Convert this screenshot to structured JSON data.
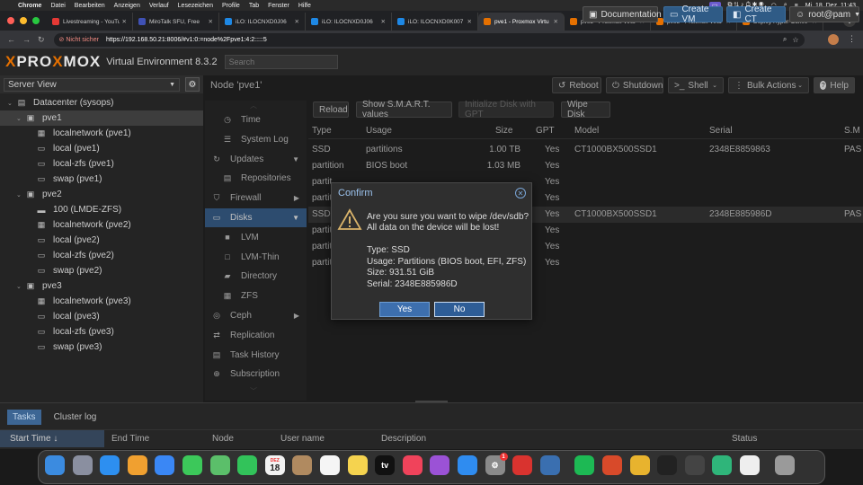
{
  "menubar": {
    "apple": "",
    "app": "Chrome",
    "items": [
      "Datei",
      "Bearbeiten",
      "Anzeigen",
      "Verlauf",
      "Lesezeichen",
      "Profile",
      "Tab",
      "Fenster",
      "Hilfe"
    ],
    "datetime": "Mi. 18. Dez.  11:43"
  },
  "tabs": [
    {
      "label": "Livestreaming - YouTube",
      "color": "#e53935"
    },
    {
      "label": "MiroTalk SFU, Free",
      "color": "#3f51b5"
    },
    {
      "label": "iLO: ILOCNXD0J06",
      "color": "#1e88e5"
    },
    {
      "label": "iLO: ILOCNXD0J06",
      "color": "#1e88e5"
    },
    {
      "label": "iLO: ILOCNXD0K007",
      "color": "#1e88e5"
    },
    {
      "label": "pve1 - Proxmox Virtu",
      "color": "#e57000",
      "active": true
    },
    {
      "label": "pve2 - Proxmox Virtu",
      "color": "#e57000"
    },
    {
      "label": "pve3 - Proxmox Virtu",
      "color": "#e57000"
    },
    {
      "label": "Deploy Hyper-Conve",
      "color": "#e57000"
    }
  ],
  "address": {
    "secure": "Nicht sicher",
    "url": "https://192.168.50.21:8006/#v1:0:=node%2Fpve1:4:2:::::5"
  },
  "header": {
    "logo_a": "PRO",
    "logo_x": "X",
    "logo_b": "MOX",
    "logo_prefix": "",
    "product": "Virtual Environment 8.3.2",
    "search_placeholder": "Search",
    "documentation": "Documentation",
    "create_vm": "Create VM",
    "create_ct": "Create CT",
    "user": "root@pam"
  },
  "left": {
    "view": "Server View",
    "tree": [
      {
        "label": "Datacenter (sysops)",
        "indent": 0,
        "icon": "datacenter-icon",
        "glyph": "▤"
      },
      {
        "label": "pve1",
        "indent": 1,
        "icon": "node-icon",
        "glyph": "▣",
        "selected": true
      },
      {
        "label": "localnetwork (pve1)",
        "indent": 2,
        "icon": "network-icon",
        "glyph": "▦"
      },
      {
        "label": "local (pve1)",
        "indent": 2,
        "icon": "storage-icon",
        "glyph": "▭"
      },
      {
        "label": "local-zfs (pve1)",
        "indent": 2,
        "icon": "storage-icon",
        "glyph": "▭"
      },
      {
        "label": "swap (pve1)",
        "indent": 2,
        "icon": "storage-icon",
        "glyph": "▭"
      },
      {
        "label": "pve2",
        "indent": 1,
        "icon": "node-icon",
        "glyph": "▣"
      },
      {
        "label": "100 (LMDE-ZFS)",
        "indent": 2,
        "icon": "vm-icon",
        "glyph": "▬"
      },
      {
        "label": "localnetwork (pve2)",
        "indent": 2,
        "icon": "network-icon",
        "glyph": "▦"
      },
      {
        "label": "local (pve2)",
        "indent": 2,
        "icon": "storage-icon",
        "glyph": "▭"
      },
      {
        "label": "local-zfs (pve2)",
        "indent": 2,
        "icon": "storage-icon",
        "glyph": "▭"
      },
      {
        "label": "swap (pve2)",
        "indent": 2,
        "icon": "storage-icon",
        "glyph": "▭"
      },
      {
        "label": "pve3",
        "indent": 1,
        "icon": "node-icon",
        "glyph": "▣"
      },
      {
        "label": "localnetwork (pve3)",
        "indent": 2,
        "icon": "network-icon",
        "glyph": "▦"
      },
      {
        "label": "local (pve3)",
        "indent": 2,
        "icon": "storage-icon",
        "glyph": "▭"
      },
      {
        "label": "local-zfs (pve3)",
        "indent": 2,
        "icon": "storage-icon",
        "glyph": "▭"
      },
      {
        "label": "swap (pve3)",
        "indent": 2,
        "icon": "storage-icon",
        "glyph": "▭"
      }
    ]
  },
  "node": {
    "title": "Node 'pve1'",
    "reboot": "Reboot",
    "shutdown": "Shutdown",
    "shell": "Shell",
    "bulk": "Bulk Actions",
    "help": "Help"
  },
  "menu": [
    {
      "label": "Time",
      "icon": "clock-icon",
      "glyph": "◷",
      "sub": true
    },
    {
      "label": "System Log",
      "icon": "list-icon",
      "glyph": "☰",
      "sub": true
    },
    {
      "label": "Updates",
      "icon": "refresh-icon",
      "glyph": "↻",
      "arrow": "▼"
    },
    {
      "label": "Repositories",
      "icon": "files-icon",
      "glyph": "▤",
      "sub": true
    },
    {
      "label": "Firewall",
      "icon": "shield-icon",
      "glyph": "⛉",
      "arrow": "▶"
    },
    {
      "label": "Disks",
      "icon": "disk-icon",
      "glyph": "▭",
      "arrow": "▼",
      "active": true
    },
    {
      "label": "LVM",
      "icon": "square-icon",
      "glyph": "■",
      "sub": true
    },
    {
      "label": "LVM-Thin",
      "icon": "square-outline-icon",
      "glyph": "□",
      "sub": true
    },
    {
      "label": "Directory",
      "icon": "folder-icon",
      "glyph": "▰",
      "sub": true
    },
    {
      "label": "ZFS",
      "icon": "grid-icon",
      "glyph": "▦",
      "sub": true
    },
    {
      "label": "Ceph",
      "icon": "ceph-icon",
      "glyph": "◎",
      "arrow": "▶"
    },
    {
      "label": "Replication",
      "icon": "retweet-icon",
      "glyph": "⇄"
    },
    {
      "label": "Task History",
      "icon": "list-alt-icon",
      "glyph": "▤"
    },
    {
      "label": "Subscription",
      "icon": "support-icon",
      "glyph": "⊕"
    }
  ],
  "disk_toolbar": {
    "reload": "Reload",
    "smart": "Show S.M.A.R.T. values",
    "init": "Initialize Disk with GPT",
    "wipe": "Wipe Disk"
  },
  "columns": {
    "type": "Type",
    "usage": "Usage",
    "size": "Size",
    "gpt": "GPT",
    "model": "Model",
    "serial": "Serial",
    "sm": "S.M"
  },
  "rows": [
    {
      "type": "SSD",
      "usage": "partitions",
      "size": "1.00 TB",
      "gpt": "Yes",
      "model": "CT1000BX500SSD1",
      "serial": "2348E8859863",
      "sm": "PAS"
    },
    {
      "type": "partition",
      "usage": "BIOS boot",
      "size": "1.03 MB",
      "gpt": "Yes",
      "model": "",
      "serial": "",
      "sm": ""
    },
    {
      "type": "partit",
      "usage": "",
      "size": "",
      "gpt": "Yes",
      "model": "",
      "serial": "",
      "sm": ""
    },
    {
      "type": "partit",
      "usage": "",
      "size": "",
      "gpt": "Yes",
      "model": "",
      "serial": "",
      "sm": ""
    },
    {
      "type": "SSD",
      "usage": "",
      "size": "",
      "gpt": "Yes",
      "model": "CT1000BX500SSD1",
      "serial": "2348E885986D",
      "sm": "PAS",
      "selected": true
    },
    {
      "type": "partit",
      "usage": "",
      "size": "",
      "gpt": "Yes",
      "model": "",
      "serial": "",
      "sm": ""
    },
    {
      "type": "partit",
      "usage": "",
      "size": "",
      "gpt": "Yes",
      "model": "",
      "serial": "",
      "sm": ""
    },
    {
      "type": "partit",
      "usage": "",
      "size": "",
      "gpt": "Yes",
      "model": "",
      "serial": "",
      "sm": ""
    }
  ],
  "dialog": {
    "title": "Confirm",
    "line1": "Are you sure you want to wipe /dev/sdb?",
    "line2": "All data on the device will be lost!",
    "type": "Type: SSD",
    "usage": "Usage: Partitions (BIOS boot, EFI, ZFS)",
    "size": "Size: 931.51 GiB",
    "serial": "Serial: 2348E885986D",
    "yes": "Yes",
    "no": "No"
  },
  "bottom": {
    "tab_tasks": "Tasks",
    "tab_cluster": "Cluster log",
    "col_start": "Start Time ↓",
    "col_end": "End Time",
    "col_node": "Node",
    "col_user": "User name",
    "col_desc": "Description",
    "col_status": "Status"
  },
  "dock": [
    {
      "name": "finder-icon",
      "color": "#3b8be0"
    },
    {
      "name": "launchpad-icon",
      "color": "#8a8fa0"
    },
    {
      "name": "safari-icon",
      "color": "#2d8ff0"
    },
    {
      "name": "photos-icon",
      "color": "#f0a030"
    },
    {
      "name": "mail-icon",
      "color": "#3a87f5"
    },
    {
      "name": "messages-icon",
      "color": "#3cc85a"
    },
    {
      "name": "maps-icon",
      "color": "#5bbf6a"
    },
    {
      "name": "facetime-icon",
      "color": "#32c35a"
    },
    {
      "name": "calendar-icon",
      "color": "#f2f2f2"
    },
    {
      "name": "contacts-icon",
      "color": "#b08a60"
    },
    {
      "name": "reminders-icon",
      "color": "#f5f5f5"
    },
    {
      "name": "notes-icon",
      "color": "#f5d34f"
    },
    {
      "name": "appletv-icon",
      "color": "#111111"
    },
    {
      "name": "music-icon",
      "color": "#f0435b"
    },
    {
      "name": "podcasts-icon",
      "color": "#9b52d6"
    },
    {
      "name": "appstore-icon",
      "color": "#2f8cf0"
    },
    {
      "name": "settings-icon",
      "color": "#8a8a8a"
    },
    {
      "name": "vpn-icon",
      "color": "#d9332f"
    },
    {
      "name": "network-tool-icon",
      "color": "#3a6fb0"
    },
    {
      "name": "spotify-icon",
      "color": "#1db954"
    },
    {
      "name": "scrobbler-icon",
      "color": "#d84a2a"
    },
    {
      "name": "chrome-icon",
      "color": "#e8b32e"
    },
    {
      "name": "terminal-icon",
      "color": "#222222"
    },
    {
      "name": "calculator-icon",
      "color": "#444444"
    },
    {
      "name": "sync-icon",
      "color": "#2fb57a"
    },
    {
      "name": "document-icon",
      "color": "#eeeeee"
    },
    {
      "name": "trash-icon",
      "color": "#9a9a9a"
    }
  ],
  "dock_labels": {
    "calendar_month": "DEZ",
    "calendar_day": "18",
    "tv": "tv",
    "badge": "1"
  },
  "colors": {
    "accent": "#3d6694",
    "orange": "#e57000",
    "dialog_title": "#9cc3ee"
  }
}
